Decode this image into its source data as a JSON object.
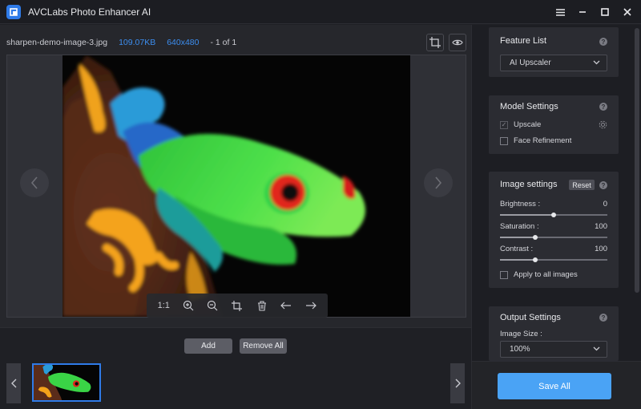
{
  "window": {
    "title": "AVCLabs Photo Enhancer AI",
    "controls": [
      "menu-icon",
      "minimize-icon",
      "maximize-icon",
      "close-icon"
    ]
  },
  "file": {
    "name": "sharpen-demo-image-3.jpg",
    "size": "109.07KB",
    "dimensions": "640x480",
    "counter": "- 1 of 1"
  },
  "viewer_toolbar": {
    "actual_size_label": "1:1",
    "tools": [
      "zoom-in-icon",
      "zoom-out-icon",
      "crop-icon",
      "delete-icon",
      "arrow-left-icon",
      "arrow-right-icon"
    ]
  },
  "actions": {
    "add_label": "Add",
    "remove_all_label": "Remove All"
  },
  "panel": {
    "feature_list": {
      "title": "Feature List",
      "selected": "AI Upscaler"
    },
    "model_settings": {
      "title": "Model Settings",
      "options": [
        {
          "label": "Upscale",
          "checked": true
        },
        {
          "label": "Face Refinement",
          "checked": false
        }
      ]
    },
    "image_settings": {
      "title": "Image settings",
      "reset_label": "Reset",
      "sliders": [
        {
          "label": "Brightness :",
          "value": "0",
          "fraction": 0.5
        },
        {
          "label": "Saturation :",
          "value": "100",
          "fraction": 0.33
        },
        {
          "label": "Contrast :",
          "value": "100",
          "fraction": 0.33
        }
      ],
      "apply_all_label": "Apply to all images"
    },
    "output_settings": {
      "title": "Output Settings",
      "image_size_label": "Image Size :",
      "image_size_value": "100%"
    },
    "save_all_label": "Save All"
  },
  "colors": {
    "accent": "#2f7be8",
    "save_button": "#4aa3f5",
    "file_info_highlight": "#3c8ef0"
  }
}
